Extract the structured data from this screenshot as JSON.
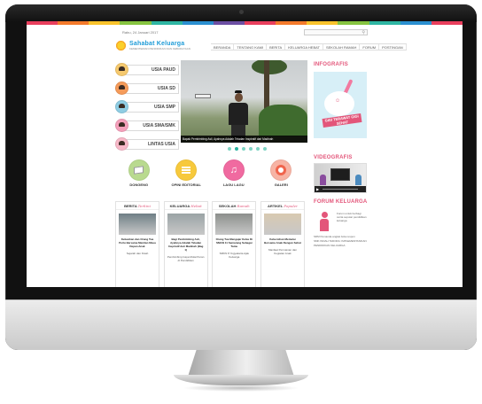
{
  "colors": {
    "colorbar": [
      "#e83e5c",
      "#f47a2a",
      "#f9c32b",
      "#86c440",
      "#2eb6a3",
      "#2a8fd0",
      "#6c4fa3",
      "#e83e5c",
      "#f47a2a",
      "#f9c32b",
      "#86c440",
      "#2eb6a3",
      "#2a8fd0",
      "#e83e5c"
    ],
    "accent": "#e3567a",
    "teal": "#2ab3a1"
  },
  "header": {
    "date": "Rabu, 24 Januari 2017",
    "search_placeholder": "",
    "logo_title": "Sahabat Keluarga",
    "logo_subtitle": "KEMENTERIAN PENDIDIKAN DAN KEBUDAYAAN"
  },
  "nav": [
    "BERANDA",
    "TENTANG KAMI",
    "BERITA",
    "KELUARGA HEBAT",
    "SEKOLAH RAMAH",
    "FORUM",
    "POSTINGAN"
  ],
  "categories": [
    {
      "label": "USIA PAUD",
      "color": "#f6c96e"
    },
    {
      "label": "USIA SD",
      "color": "#f59b5a"
    },
    {
      "label": "USIA SMP",
      "color": "#8fcde3"
    },
    {
      "label": "USIA SMA/SMK",
      "color": "#f5a0bb"
    },
    {
      "label": "LINTAS USIA",
      "color": "#f7b8c8"
    }
  ],
  "hero": {
    "caption": "Bapak Pembimbing Asli, Ayahnya Adalah Teladan Inspiratif dari Madinah"
  },
  "sidebar": {
    "infografis_title": "INFOGRAFIS",
    "infografis_banner": "GIGI TERAWAT GIGI SEHAT",
    "videografis_title": "VIDEOGRAFIS",
    "forum_title": "FORUM KELUARGA",
    "forum_text": "Forum untuk berbagi cerita seputar pendidikan keluarga",
    "forum_links": [
      "SDM Pemanda angkat bola respon",
      "SMK INDAH TADORA: IMPLEMENTASIKAN PENDIDIKAN KELUARGA"
    ]
  },
  "features": [
    {
      "label": "DONGENG",
      "color": "#b9da8f"
    },
    {
      "label": "OPINI EDITORIAL",
      "color": "#f7c93c"
    },
    {
      "label": "LAGU LAGU",
      "color": "#f06aa0"
    },
    {
      "label": "GALERI",
      "color": "#f7b3a4"
    }
  ],
  "news": [
    {
      "head": "BERITA",
      "head_italic": "Terkini",
      "img": "#6f7f86",
      "title": "Keluarkan dan Orang Tua Perlu Bersama Menitan Masa Depan Anak",
      "sub": "Sejarah dan Kisah"
    },
    {
      "head": "KELUARGA",
      "head_italic": "Hebat",
      "img": "#9aa3a5",
      "title": "Bagi Pembimbing Asli, Ayahnya Adalah Teladan Inspiratif dari Madinah (Bag 1)",
      "sub": "Pembimbing Gaya Mulai Peran di Pendidikan"
    },
    {
      "head": "SEKOLAH",
      "head_italic": "Ramah",
      "img": "#8c8f8c",
      "title": "Orang Tua Mengajar Kelas Di SMAN 11 Semarang Sebagai Tamu",
      "sub": "SMKN 8 Yogyakarta Ajak Keluarga"
    },
    {
      "head": "ARTIKEL",
      "head_italic": "Populer",
      "img": "#d8c9b0",
      "title": "Kebersihan Memulai Bersama Anak Dengan Sehat",
      "sub": "Manfaat Permainan dan Kegiatan Anak"
    }
  ]
}
